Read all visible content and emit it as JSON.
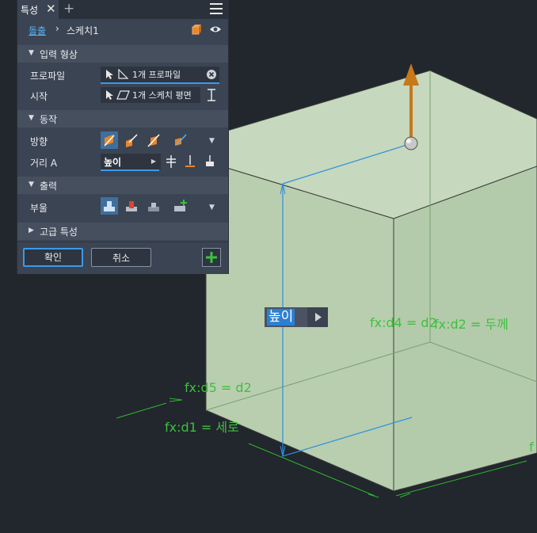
{
  "panel": {
    "tab_label": "특성",
    "tab_close": "✕",
    "tab_add": "+",
    "breadcrumb": {
      "link": "돌출",
      "separator": "›",
      "current": "스케치1"
    },
    "sections": {
      "input_shape": "입력 형상",
      "behavior": "동작",
      "output": "출력",
      "advanced": "고급 특성"
    },
    "rows": {
      "profile": {
        "label": "프로파일",
        "value": "1개 프로파일"
      },
      "start": {
        "label": "시작",
        "value": "1개 스케치 평면"
      },
      "direction": {
        "label": "방향"
      },
      "distance": {
        "label": "거리 A",
        "value": "높이"
      },
      "solid": {
        "label": "부울"
      }
    },
    "buttons": {
      "ok": "확인",
      "cancel": "취소"
    }
  },
  "viewport": {
    "edit_value": "높이",
    "dimensions": {
      "d4": "fx:d4 = d2",
      "d2": "fx:d2 = 두께",
      "d5": "fx:d5 = d2",
      "d1": "fx:d1 = 세로",
      "edge_fragment": "f"
    }
  },
  "colors": {
    "accent": "#3b9ae8",
    "panel_bg": "#3b4453",
    "viewport_bg": "#22262d",
    "dimension_green": "#3fbf3f",
    "cube_face": "#b8d0b0",
    "arrow_orange": "#c87818"
  }
}
